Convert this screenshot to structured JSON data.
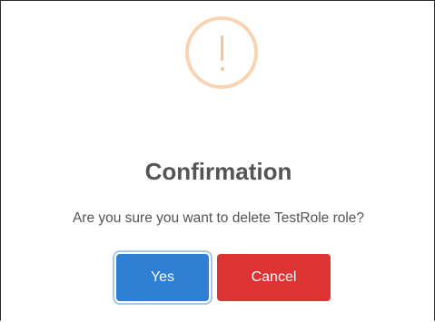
{
  "dialog": {
    "icon": "warning-exclamation-icon",
    "title": "Confirmation",
    "message": "Are you sure you want to delete TestRole role?",
    "confirm_label": "Yes",
    "cancel_label": "Cancel"
  },
  "colors": {
    "icon_ring": "#f8d4b2",
    "icon_mark": "#f6c39a",
    "confirm": "#2f7fd4",
    "cancel": "#dd3333",
    "text": "#545454"
  }
}
